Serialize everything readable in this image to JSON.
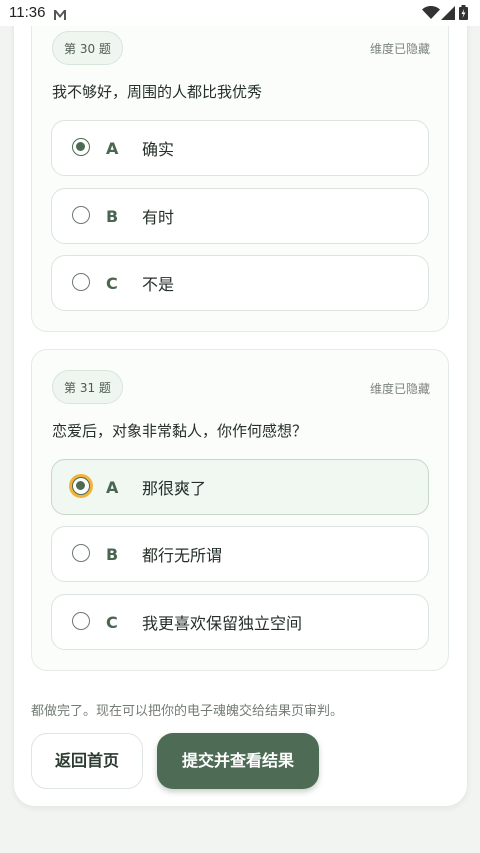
{
  "status_bar": {
    "time": "11:36",
    "icons": [
      "mail-icon",
      "wifi-icon",
      "signal-icon",
      "battery-icon"
    ]
  },
  "questions": [
    {
      "number": "第 30 题",
      "dimension_status": "维度已隐藏",
      "text": "我不够好，周围的人都比我优秀",
      "options": [
        {
          "letter": "A",
          "text": "确实",
          "selected": true
        },
        {
          "letter": "B",
          "text": "有时",
          "selected": false
        },
        {
          "letter": "C",
          "text": "不是",
          "selected": false
        }
      ]
    },
    {
      "number": "第 31 题",
      "dimension_status": "维度已隐藏",
      "text": "恋爱后，对象非常黏人，你作何感想？",
      "options": [
        {
          "letter": "A",
          "text": "那很爽了",
          "selected": true
        },
        {
          "letter": "B",
          "text": "都行无所谓",
          "selected": false
        },
        {
          "letter": "C",
          "text": "我更喜欢保留独立空间",
          "selected": false
        }
      ]
    }
  ],
  "footer": {
    "hint": "都做完了。现在可以把你的电子魂魄交给结果页审判。",
    "home_button": "返回首页",
    "submit_button": "提交并查看结果"
  },
  "colors": {
    "accent": "#4e6b55",
    "focus_ring": "#f1b33c",
    "background": "#f1f4f1"
  }
}
